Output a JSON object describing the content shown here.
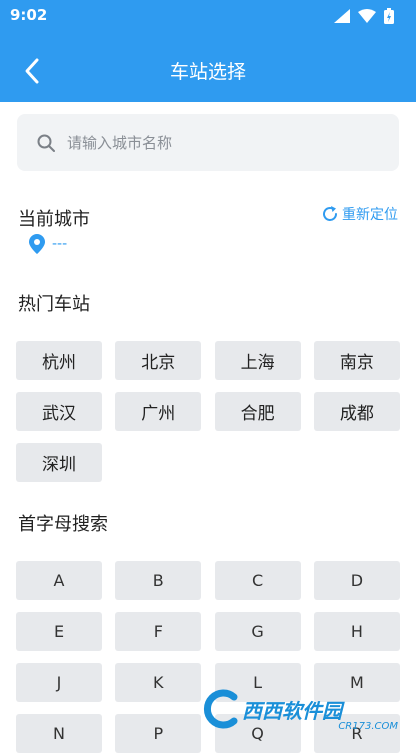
{
  "status_bar": {
    "time": "9:02"
  },
  "header": {
    "title": "车站选择"
  },
  "search": {
    "placeholder": "请输入城市名称",
    "value": ""
  },
  "current_city": {
    "heading": "当前城市",
    "relocate_label": "重新定位",
    "value": "---"
  },
  "hot_stations": {
    "heading": "热门车站",
    "items": [
      "杭州",
      "北京",
      "上海",
      "南京",
      "武汉",
      "广州",
      "合肥",
      "成都",
      "深圳"
    ]
  },
  "letter_search": {
    "heading": "首字母搜索",
    "letters": [
      "A",
      "B",
      "C",
      "D",
      "E",
      "F",
      "G",
      "H",
      "J",
      "K",
      "L",
      "M",
      "N",
      "P",
      "Q",
      "R"
    ]
  },
  "watermark": {
    "logo_text": "西西软件园",
    "sub_text": "CR173.COM"
  },
  "colors": {
    "accent": "#2f9bf0",
    "cell_bg": "#e7e9ec",
    "search_bg": "#f1f3f5"
  }
}
